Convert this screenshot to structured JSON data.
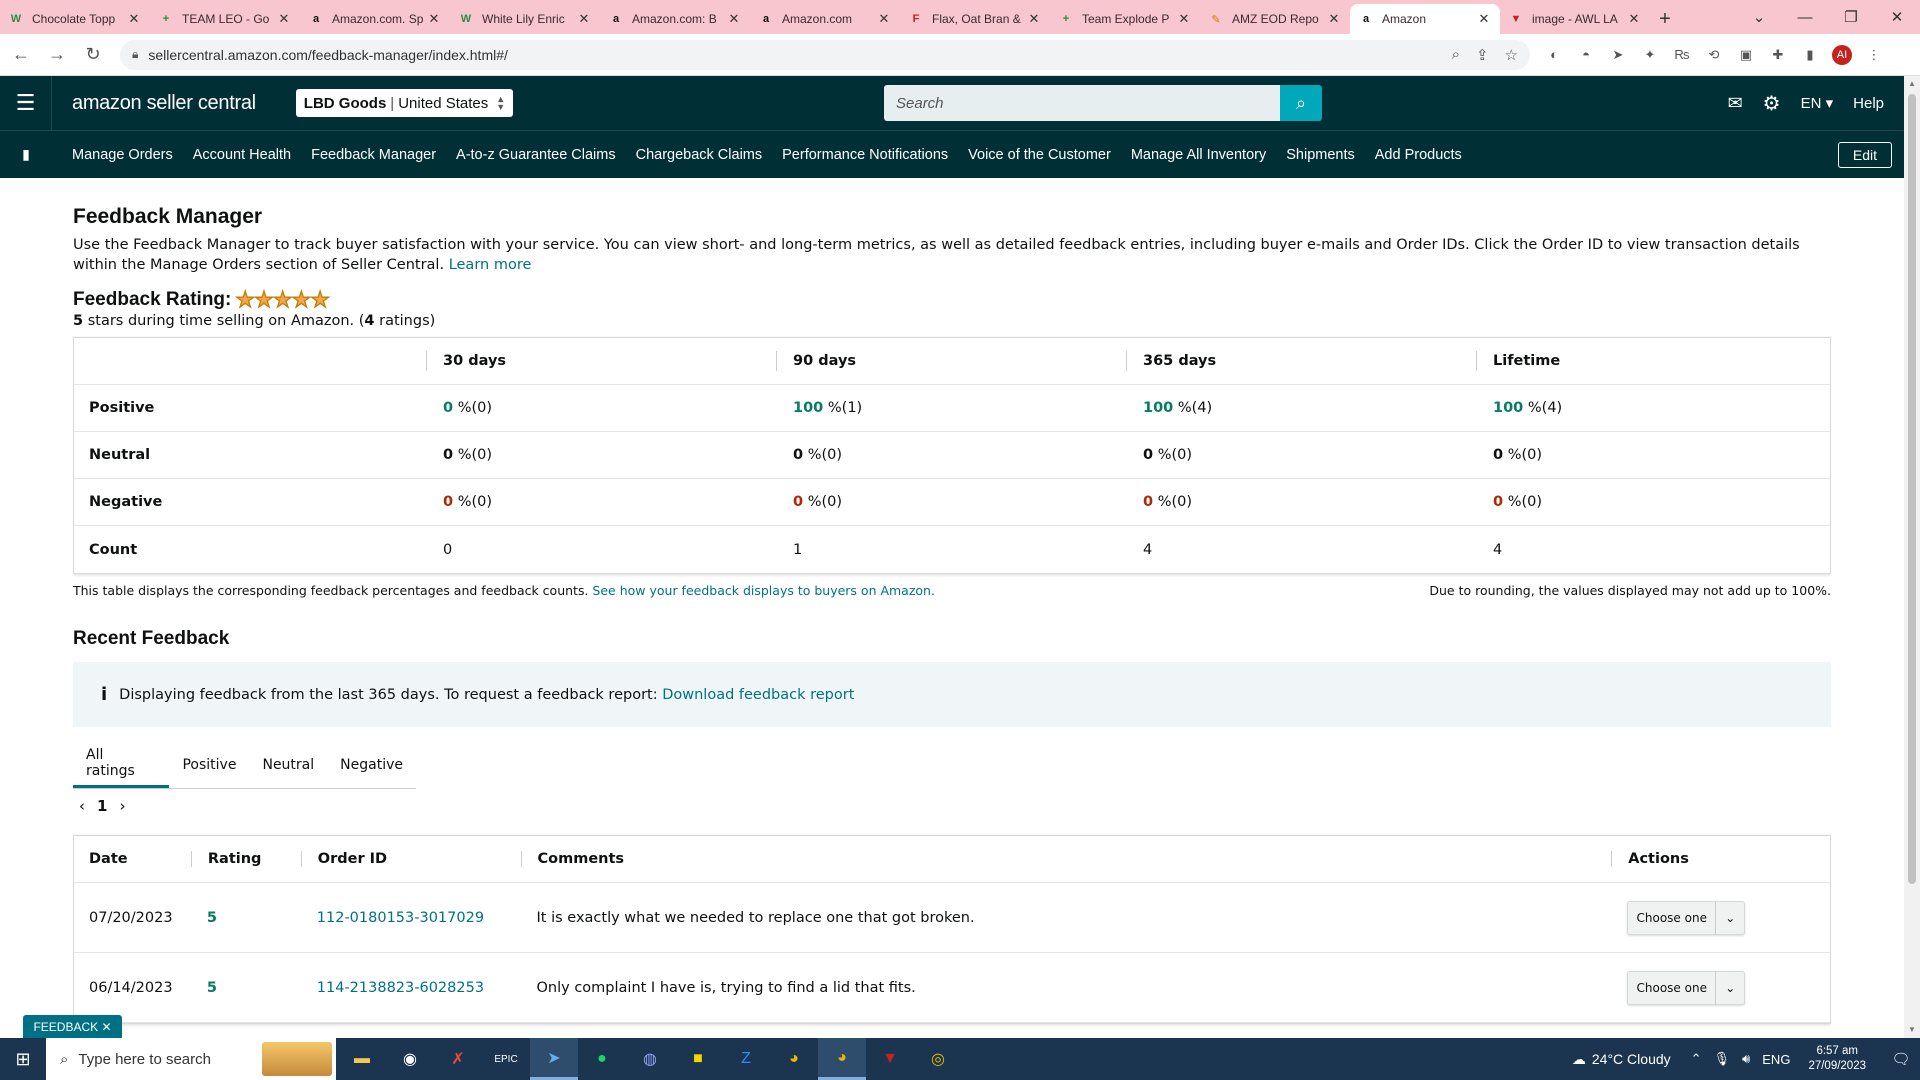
{
  "browser": {
    "tabs": [
      {
        "title": "Chocolate Topp",
        "icon": "W",
        "color": "#2a8c4a",
        "active": false
      },
      {
        "title": "TEAM LEO - Go",
        "icon": "+",
        "color": "#1e8e3e",
        "active": false
      },
      {
        "title": "Amazon.com. Sp",
        "icon": "a",
        "color": "#111",
        "active": false
      },
      {
        "title": "White Lily Enric",
        "icon": "W",
        "color": "#2a8c4a",
        "active": false
      },
      {
        "title": "Amazon.com: B",
        "icon": "a",
        "color": "#111",
        "active": false
      },
      {
        "title": "Amazon.com",
        "icon": "a",
        "color": "#111",
        "active": false
      },
      {
        "title": "Flax, Oat Bran &",
        "icon": "F",
        "color": "#c5221f",
        "active": false
      },
      {
        "title": "Team Explode P",
        "icon": "+",
        "color": "#1e8e3e",
        "active": false
      },
      {
        "title": "AMZ EOD Repo",
        "icon": "✎",
        "color": "#e37400",
        "active": false
      },
      {
        "title": "Amazon",
        "icon": "a",
        "color": "#111",
        "active": true
      },
      {
        "title": "image - AWL LA",
        "icon": "▼",
        "color": "#c5221f",
        "active": false
      }
    ],
    "url": "sellercentral.amazon.com/feedback-manager/index.html#/"
  },
  "header": {
    "logo_text": "amazon seller central",
    "account_name": "LBD Goods",
    "account_region": "United States",
    "search_placeholder": "Search",
    "language": "EN ▾",
    "help": "Help"
  },
  "nav": {
    "items": [
      "Manage Orders",
      "Account Health",
      "Feedback Manager",
      "A-to-z Guarantee Claims",
      "Chargeback Claims",
      "Performance Notifications",
      "Voice of the Customer",
      "Manage All Inventory",
      "Shipments",
      "Add Products"
    ],
    "edit_label": "Edit"
  },
  "page": {
    "title": "Feedback Manager",
    "description": "Use the Feedback Manager to track buyer satisfaction with your service. You can view short- and long-term metrics, as well as detailed feedback entries, including buyer e-mails and Order IDs. Click the Order ID to view transaction details within the Manage Orders section of Seller Central.",
    "learn_more": "Learn more",
    "rating_label": "Feedback Rating:",
    "stars": "★★★★★",
    "rating_stars_value": "5",
    "rating_sub_mid": " stars during time selling on Amazon. (",
    "rating_count": "4",
    "rating_sub_end": " ratings)"
  },
  "summary": {
    "columns": [
      "30 days",
      "90 days",
      "365 days",
      "Lifetime"
    ],
    "rows": [
      {
        "label": "Positive",
        "cells": [
          [
            "0",
            " %(0)"
          ],
          [
            "100",
            " %(1)"
          ],
          [
            "100",
            " %(4)"
          ],
          [
            "100",
            " %(4)"
          ]
        ],
        "tone": "g"
      },
      {
        "label": "Neutral",
        "cells": [
          [
            "0",
            " %(0)"
          ],
          [
            "0",
            " %(0)"
          ],
          [
            "0",
            " %(0)"
          ],
          [
            "0",
            " %(0)"
          ]
        ],
        "tone": "k"
      },
      {
        "label": "Negative",
        "cells": [
          [
            "0",
            " %(0)"
          ],
          [
            "0",
            " %(0)"
          ],
          [
            "0",
            " %(0)"
          ],
          [
            "0",
            " %(0)"
          ]
        ],
        "tone": "r"
      },
      {
        "label": "Count",
        "cells": [
          [
            "",
            "0"
          ],
          [
            "",
            "1"
          ],
          [
            "",
            "4"
          ],
          [
            "",
            "4"
          ]
        ],
        "tone": ""
      }
    ],
    "footnote_text": "This table displays the corresponding feedback percentages and feedback counts.",
    "footnote_link": "See how your feedback displays to buyers on Amazon.",
    "rounding_note": "Due to rounding, the values displayed may not add up to 100%."
  },
  "recent": {
    "title": "Recent Feedback",
    "info_text": "Displaying feedback from the last 365 days. To request a feedback report:",
    "info_link": "Download feedback report",
    "tabs": [
      "All ratings",
      "Positive",
      "Neutral",
      "Negative"
    ],
    "page": "1",
    "columns": [
      "Date",
      "Rating",
      "Order ID",
      "Comments",
      "Actions"
    ],
    "rows": [
      {
        "date": "07/20/2023",
        "rating": "5",
        "order": "112-0180153-3017029",
        "comment": "It is exactly what we needed to replace one that got broken.",
        "action": "Choose one"
      },
      {
        "date": "06/14/2023",
        "rating": "5",
        "order": "114-2138823-6028253",
        "comment": "Only complaint I have is, trying to find a lid that fits.",
        "action": "Choose one"
      }
    ],
    "feedback_tag": "FEEDBACK ✕"
  },
  "taskbar": {
    "search_placeholder": "Type here to search",
    "weather": "24°C  Cloudy",
    "lang": "ENG",
    "time": "6:57 am",
    "date": "27/09/2023"
  }
}
